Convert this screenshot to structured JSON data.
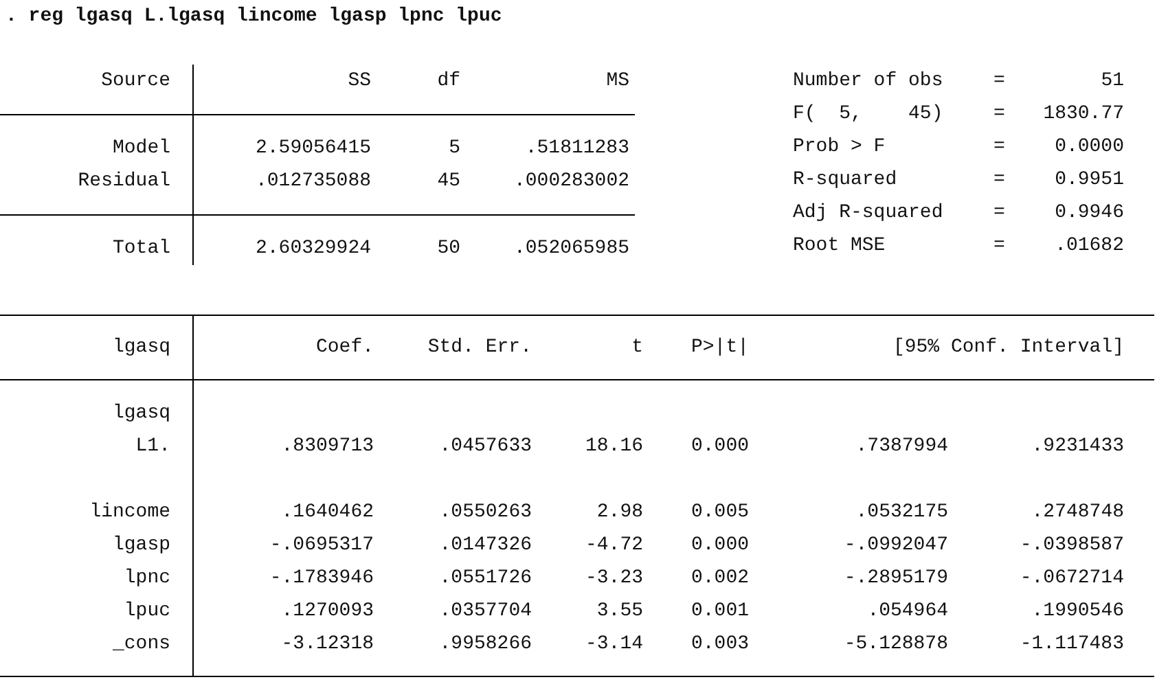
{
  "command": ". reg lgasq L.lgasq lincome lgasp lpnc lpuc",
  "anova": {
    "columns": [
      "Source",
      "SS",
      "df",
      "MS"
    ],
    "groups": [
      [
        {
          "name": "Model",
          "values": [
            "2.59056415",
            "5",
            ".51811283"
          ]
        },
        {
          "name": "Residual",
          "values": [
            ".012735088",
            "45",
            ".000283002"
          ]
        }
      ],
      [
        {
          "name": "Total",
          "values": [
            "2.60329924",
            "50",
            ".052065985"
          ]
        }
      ]
    ]
  },
  "stats": [
    {
      "label": "Number of obs",
      "sep": "=",
      "value": "51"
    },
    {
      "label": "F(  5,    45)",
      "sep": "=",
      "value": "1830.77"
    },
    {
      "label": "Prob > F",
      "sep": "=",
      "value": "0.0000"
    },
    {
      "label": "R-squared",
      "sep": "=",
      "value": "0.9951"
    },
    {
      "label": "Adj R-squared",
      "sep": "=",
      "value": "0.9946"
    },
    {
      "label": "Root MSE",
      "sep": "=",
      "value": ".01682"
    }
  ],
  "coefficients": {
    "columns": [
      "lgasq",
      "Coef.",
      "Std. Err.",
      "t",
      "P>|t|",
      "[95% Conf. Interval]"
    ],
    "groups": [
      [
        {
          "kind": "label",
          "name": "lgasq"
        },
        {
          "kind": "estimate",
          "name": "L1.",
          "values": [
            ".8309713",
            ".0457633",
            "18.16",
            "0.000",
            ".7387994",
            ".9231433"
          ]
        }
      ],
      [
        {
          "kind": "estimate",
          "name": "lincome",
          "values": [
            ".1640462",
            ".0550263",
            "2.98",
            "0.005",
            ".0532175",
            ".2748748"
          ]
        },
        {
          "kind": "estimate",
          "name": "lgasp",
          "values": [
            "-.0695317",
            ".0147326",
            "-4.72",
            "0.000",
            "-.0992047",
            "-.0398587"
          ]
        },
        {
          "kind": "estimate",
          "name": "lpnc",
          "values": [
            "-.1783946",
            ".0551726",
            "-3.23",
            "0.002",
            "-.2895179",
            "-.0672714"
          ]
        },
        {
          "kind": "estimate",
          "name": "lpuc",
          "values": [
            ".1270093",
            ".0357704",
            "3.55",
            "0.001",
            ".054964",
            ".1990546"
          ]
        },
        {
          "kind": "estimate",
          "name": "_cons",
          "values": [
            "-3.12318",
            ".9958266",
            "-3.14",
            "0.003",
            "-5.128878",
            "-1.117483"
          ]
        }
      ]
    ]
  }
}
